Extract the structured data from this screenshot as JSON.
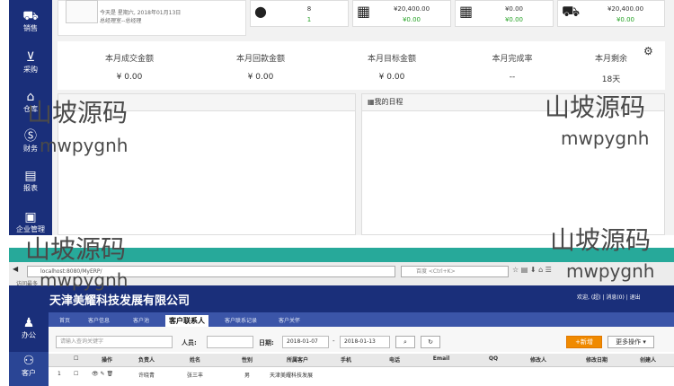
{
  "top": {
    "sidebar": [
      {
        "icon": "cart-icon",
        "glyph": "🛒",
        "label": "销售"
      },
      {
        "icon": "basket-icon",
        "glyph": "🧺",
        "label": "采购"
      },
      {
        "icon": "warehouse-icon",
        "glyph": "🏠",
        "label": "仓库"
      },
      {
        "icon": "dollar-icon",
        "glyph": "$",
        "label": "财务"
      },
      {
        "icon": "report-icon",
        "glyph": "▤",
        "label": "报表"
      },
      {
        "icon": "briefcase-icon",
        "glyph": "💼",
        "label": "企业管理"
      }
    ],
    "profile": {
      "line1": "今天是  星期六, 2018年01月13日",
      "line2": "总经理室--总经理"
    },
    "stats": [
      {
        "icon": "user-icon",
        "l1": "8",
        "l2": "1"
      },
      {
        "icon": "money-icon",
        "l1": "¥20,400.00",
        "l2": "¥0.00"
      },
      {
        "icon": "money2-icon",
        "l1": "¥0.00",
        "l2": "¥0.00"
      },
      {
        "icon": "cart2-icon",
        "l1": "¥20,400.00",
        "l2": "¥0.00"
      }
    ],
    "summary": [
      {
        "label": "本月成交金额",
        "value": "¥ 0.00"
      },
      {
        "label": "本月回款金额",
        "value": "¥ 0.00"
      },
      {
        "label": "本月目标金额",
        "value": "¥ 0.00"
      },
      {
        "label": "本月完成率",
        "value": "--"
      },
      {
        "label": "本月剩余",
        "value": "18天"
      }
    ],
    "schedule_title": "我的日程"
  },
  "bottom": {
    "url": "localhost:8080/MyERP/",
    "search_placeholder": "百度 <Ctrl+K>",
    "visited": "访问最多",
    "company": "天津美耀科技发展有限公司",
    "user_links": "欢迎, (超)  |  消息(0)  |  退出",
    "sidebar": [
      {
        "icon": "person-icon",
        "glyph": "👤",
        "label": "办公"
      },
      {
        "icon": "customer-icon",
        "glyph": "👥",
        "label": "客户"
      }
    ],
    "tabs": [
      "首页",
      "客户信息",
      "客户池",
      "客户联系人",
      "客户联系记录",
      "客户关怀"
    ],
    "active_tab": 3,
    "filter_placeholder": "请输入查询关键字",
    "person_label": "人员:",
    "date_label": "日期:",
    "date_from": "2018-01-07",
    "date_sep": "-",
    "date_to": "2018-01-13",
    "new_button": "+新增",
    "more_button": "更多操作 ▾",
    "columns": [
      "操作",
      "负责人",
      "姓名",
      "性别",
      "所属客户",
      "手机",
      "电话",
      "Email",
      "QQ",
      "修改人",
      "修改日期",
      "创建人"
    ],
    "rows": [
      {
        "no": "1",
        "owner": "许晓青",
        "name": "张三丰",
        "gender": "男",
        "customer": "天津美耀科技发展"
      }
    ]
  },
  "watermark": {
    "text": "山坡源码",
    "sub": "mwpygnh"
  }
}
